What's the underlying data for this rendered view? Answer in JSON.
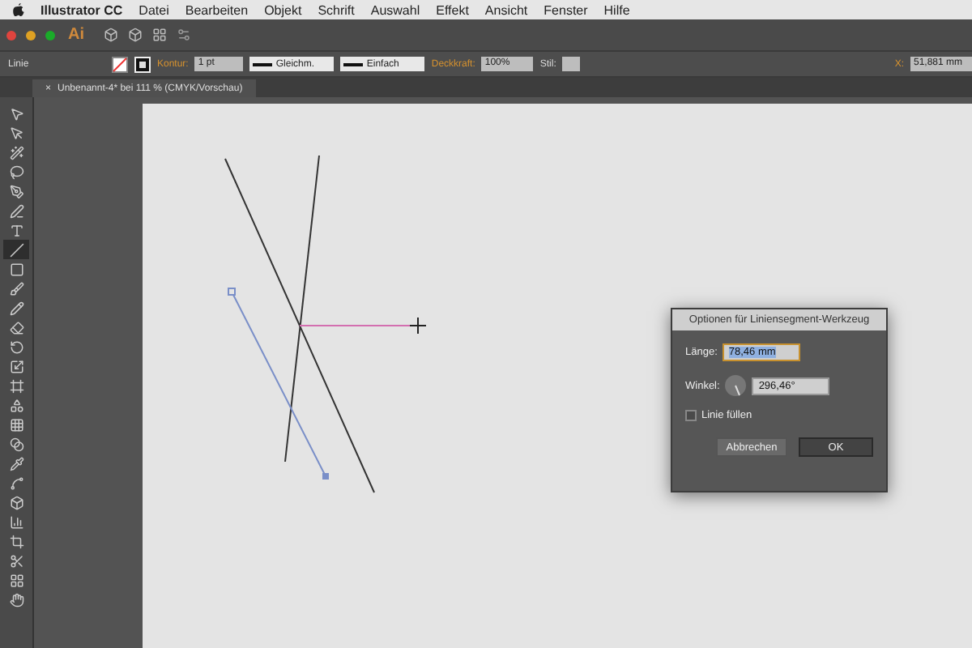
{
  "menu_bar": {
    "app_name": "Illustrator CC",
    "items": [
      "Datei",
      "Bearbeiten",
      "Objekt",
      "Schrift",
      "Auswahl",
      "Effekt",
      "Ansicht",
      "Fenster",
      "Hilfe"
    ]
  },
  "app_bar": {
    "logo": "Ai"
  },
  "control_bar": {
    "selection_label": "Linie",
    "stroke_label": "Kontur:",
    "stroke_weight": "1 pt",
    "profile": "Gleichm.",
    "brush": "Einfach",
    "opacity_label": "Deckkraft:",
    "opacity": "100%",
    "style_label": "Stil:",
    "x_label": "X:",
    "x_value": "51,881 mm"
  },
  "document_tab": {
    "close_glyph": "×",
    "title": "Unbenannt-4* bei 111 % (CMYK/Vorschau)"
  },
  "tools": [
    {
      "selected": false
    },
    {
      "selected": false
    },
    {
      "selected": false
    },
    {
      "selected": false
    },
    {
      "selected": false
    },
    {
      "selected": false
    },
    {
      "selected": false
    },
    {
      "selected": true
    },
    {
      "selected": false
    },
    {
      "selected": false
    },
    {
      "selected": false
    },
    {
      "selected": false
    },
    {
      "selected": false
    },
    {
      "selected": false
    },
    {
      "selected": false
    },
    {
      "selected": false
    },
    {
      "selected": false
    },
    {
      "selected": false
    },
    {
      "selected": false
    },
    {
      "selected": false
    },
    {
      "selected": false
    },
    {
      "selected": false
    },
    {
      "selected": false
    },
    {
      "selected": false
    },
    {
      "selected": false
    },
    {
      "selected": false
    }
  ],
  "dialog": {
    "title": "Optionen für Liniensegment-Werkzeug",
    "length_label": "Länge:",
    "length_value": "78,46 mm",
    "angle_label": "Winkel:",
    "angle_value": "296,46°",
    "fill_label": "Linie füllen",
    "fill_checked": false,
    "buttons": [
      {
        "label": "Abbrechen",
        "default": false
      },
      {
        "label": "OK",
        "default": true
      }
    ]
  }
}
